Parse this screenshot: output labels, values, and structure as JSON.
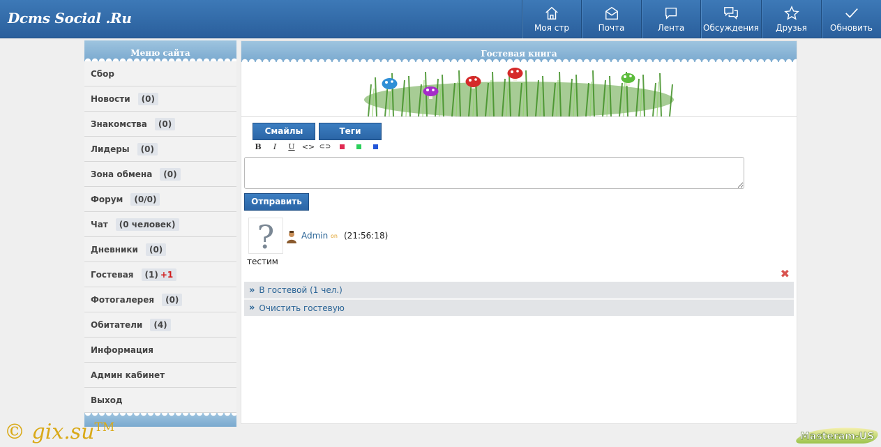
{
  "header": {
    "logo": "Dcms Social .Ru",
    "nav": [
      {
        "label": "Моя стр",
        "icon": "home-icon"
      },
      {
        "label": "Почта",
        "icon": "mail-icon"
      },
      {
        "label": "Лента",
        "icon": "feed-icon"
      },
      {
        "label": "Обсуждения",
        "icon": "discussion-icon"
      },
      {
        "label": "Друзья",
        "icon": "star-icon"
      },
      {
        "label": "Обновить",
        "icon": "check-icon"
      }
    ]
  },
  "sidebar": {
    "title": "Меню сайта",
    "items": [
      {
        "label": "Сбор",
        "count": ""
      },
      {
        "label": "Новости",
        "count": "(0)"
      },
      {
        "label": "Знакомства",
        "count": "(0)"
      },
      {
        "label": "Лидеры",
        "count": "(0)"
      },
      {
        "label": "Зона обмена",
        "count": "(0)"
      },
      {
        "label": "Форум",
        "count": "(0/0)"
      },
      {
        "label": "Чат",
        "count": "(0 человек)"
      },
      {
        "label": "Дневники",
        "count": "(0)"
      },
      {
        "label": "Гостевая",
        "count": "(1)",
        "extra": "+1"
      },
      {
        "label": "Фотогалерея",
        "count": "(0)"
      },
      {
        "label": "Обитатели",
        "count": "(4)"
      },
      {
        "label": "Информация",
        "count": ""
      },
      {
        "label": "Админ кабинет",
        "count": ""
      },
      {
        "label": "Выход",
        "count": ""
      }
    ]
  },
  "main": {
    "title": "Гостевая книга",
    "tabs": {
      "smiles": "Смайлы",
      "tags": "Теги"
    },
    "toolbar": {
      "bold": "B",
      "italic": "I",
      "underline": "U",
      "code": "<>",
      "link": "⊂⊃"
    },
    "submit": "Отправить",
    "post": {
      "avatar": "?",
      "author": "Admin",
      "status": "on",
      "time": "(21:56:18)",
      "text": "тестим"
    },
    "links": {
      "in_guest": "В гостевой (1 чел.)",
      "clear": "Очистить гостевую"
    }
  },
  "footer": {
    "copyright": "© gix.su",
    "tm": "TM",
    "badge": "Masteram-US"
  },
  "colors": {
    "accent": "#2b65a6",
    "link": "#2a6496",
    "alert": "#d01c1c"
  }
}
